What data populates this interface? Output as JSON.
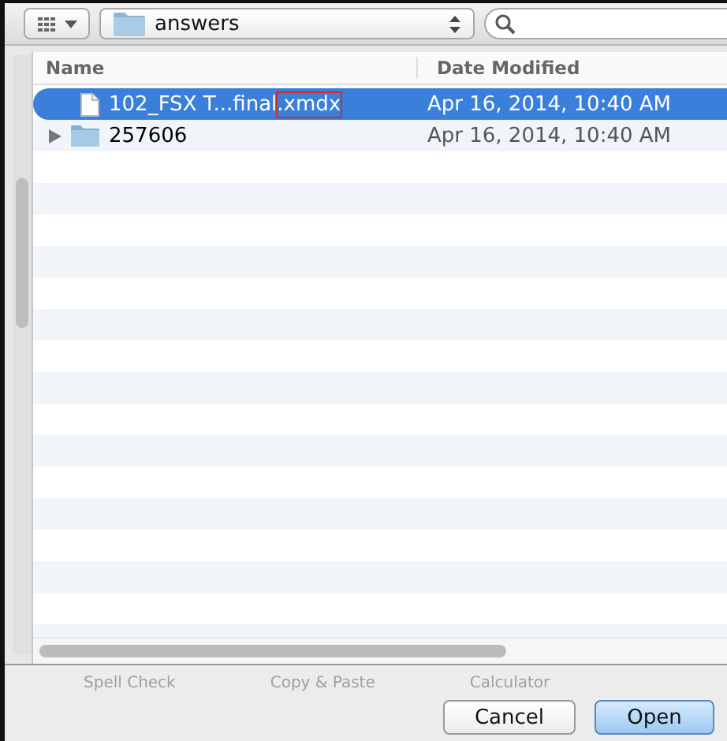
{
  "toolbar": {
    "location": "answers"
  },
  "columns": [
    "Name",
    "Date Modified"
  ],
  "rows": [
    {
      "kind": "file",
      "name": "102_FSX T...final",
      "name_highlight": ".xmdx",
      "date": "Apr 16, 2014, 10:40 AM",
      "selected": true
    },
    {
      "kind": "folder",
      "name": "257606",
      "date": "Apr 16, 2014, 10:40 AM",
      "selected": false,
      "expanded": false
    }
  ],
  "background_labels": [
    "Spell Check",
    "Copy & Paste",
    "Calculator"
  ],
  "buttons": [
    {
      "label": "Cancel",
      "default": false
    },
    {
      "label": "Open",
      "default": true
    }
  ]
}
